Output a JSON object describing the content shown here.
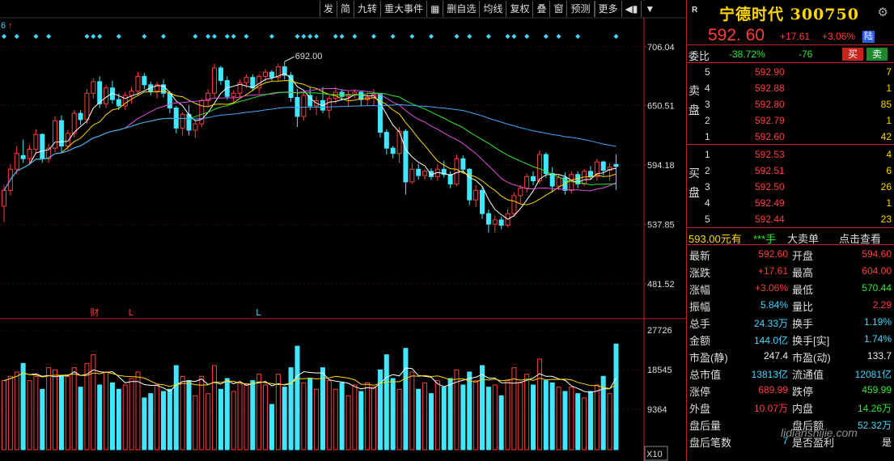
{
  "toolbar": {
    "items": [
      "发",
      "简",
      "九转",
      "重大事件",
      "",
      "删自选",
      "均线",
      "复权",
      "叠",
      "窗",
      "预测",
      "",
      "更多",
      "",
      ""
    ]
  },
  "header": {
    "r_badge": "R",
    "title": "宁德时代 300750",
    "settings_icon": "gear-icon"
  },
  "quote": {
    "price": "592. 60",
    "change": "+17.61",
    "change_pct": "+3.06%",
    "market_badge": "陆"
  },
  "weibi": {
    "label": "委比",
    "ratio": "-38.72%",
    "diff": "-76",
    "buy_label": "买",
    "sell_label": "卖"
  },
  "order_book": {
    "ask_side_label": [
      "卖",
      "盘"
    ],
    "bid_side_label": [
      "买",
      "盘"
    ],
    "asks": [
      {
        "level": "5",
        "price": "592.90",
        "vol": "7"
      },
      {
        "level": "4",
        "price": "592.88",
        "vol": "1"
      },
      {
        "level": "3",
        "price": "592.80",
        "vol": "85"
      },
      {
        "level": "2",
        "price": "592.79",
        "vol": "1"
      },
      {
        "level": "1",
        "price": "592.60",
        "vol": "42"
      }
    ],
    "bids": [
      {
        "level": "1",
        "price": "592.53",
        "vol": "4"
      },
      {
        "level": "2",
        "price": "592.51",
        "vol": "6"
      },
      {
        "level": "3",
        "price": "592.50",
        "vol": "26"
      },
      {
        "level": "4",
        "price": "592.49",
        "vol": "1"
      },
      {
        "level": "5",
        "price": "592.44",
        "vol": "23"
      }
    ]
  },
  "big_order": {
    "price": "593.00元有",
    "hand": "***手",
    "trade": "大卖单",
    "query": "点击查看"
  },
  "stats": [
    {
      "l1": "最新",
      "v1": "592.60",
      "c1": "red",
      "l2": "开盘",
      "v2": "594.60",
      "c2": "red"
    },
    {
      "l1": "涨跌",
      "v1": "+17.61",
      "c1": "red",
      "l2": "最高",
      "v2": "604.00",
      "c2": "red"
    },
    {
      "l1": "涨幅",
      "v1": "+3.06%",
      "c1": "red",
      "l2": "最低",
      "v2": "570.44",
      "c2": "green"
    },
    {
      "l1": "振幅",
      "v1": "5.84%",
      "c1": "cyan",
      "l2": "量比",
      "v2": "2.29",
      "c2": "red"
    },
    {
      "l1": "总手",
      "v1": "24.33万",
      "c1": "cyan",
      "l2": "换手",
      "v2": "1.19%",
      "c2": "cyan"
    },
    {
      "l1": "金额",
      "v1": "144.0亿",
      "c1": "cyan",
      "l2": "换手[实]",
      "v2": "1.74%",
      "c2": "cyan"
    },
    {
      "l1": "市盈(静)",
      "v1": "247.4",
      "c1": "white",
      "l2": "市盈(动)",
      "v2": "133.7",
      "c2": "white"
    },
    {
      "l1": "总市值",
      "v1": "13813亿",
      "c1": "cyan",
      "l2": "流通值",
      "v2": "12081亿",
      "c2": "cyan"
    },
    {
      "l1": "涨停",
      "v1": "689.99",
      "c1": "red",
      "l2": "跌停",
      "v2": "459.99",
      "c2": "green"
    },
    {
      "l1": "外盘",
      "v1": "10.07万",
      "c1": "red",
      "l2": "内盘",
      "v2": "14.26万",
      "c2": "green"
    },
    {
      "l1": "盘后量",
      "v1": "",
      "c1": "cyan",
      "l2": "盘后额",
      "v2": "52.32万",
      "c2": "cyan"
    },
    {
      "l1": "盘后笔数",
      "v1": "7",
      "c1": "cyan",
      "l2": "是否盈利",
      "v2": "是",
      "c2": "white"
    }
  ],
  "watermark": "lidianshijie.com",
  "chart_data": {
    "type": "candlestick",
    "price_axis_labels": [
      "706.04",
      "650.51",
      "594.18",
      "537.85",
      "481.52"
    ],
    "price_ticks": [
      706.04,
      650.51,
      594.18,
      537.85,
      481.52
    ],
    "volume_axis_labels": [
      "27726",
      "18545",
      "9364"
    ],
    "volume_ticks": [
      27726,
      18545,
      9364
    ],
    "volume_unit": "X10",
    "corner_label": "6",
    "high_annotation": "692.00",
    "markers": [
      {
        "text": "财",
        "bar": 14
      },
      {
        "text": "L",
        "bar": 20
      },
      {
        "text": "L",
        "bar": 40
      }
    ],
    "ohlc": [
      [
        555,
        575,
        540,
        570
      ],
      [
        570,
        595,
        565,
        590
      ],
      [
        590,
        612,
        585,
        605
      ],
      [
        603,
        618,
        596,
        600
      ],
      [
        600,
        613,
        594,
        609
      ],
      [
        609,
        628,
        605,
        623
      ],
      [
        623,
        624,
        596,
        600
      ],
      [
        600,
        614,
        596,
        610
      ],
      [
        610,
        640,
        606,
        636
      ],
      [
        636,
        641,
        606,
        612
      ],
      [
        612,
        627,
        608,
        624
      ],
      [
        624,
        646,
        620,
        643
      ],
      [
        643,
        646,
        632,
        637
      ],
      [
        637,
        666,
        633,
        662
      ],
      [
        662,
        676,
        657,
        673
      ],
      [
        673,
        678,
        648,
        652
      ],
      [
        652,
        670,
        648,
        667
      ],
      [
        667,
        674,
        652,
        656
      ],
      [
        656,
        662,
        646,
        650
      ],
      [
        650,
        663,
        646,
        660
      ],
      [
        660,
        668,
        652,
        664
      ],
      [
        664,
        682,
        660,
        678
      ],
      [
        678,
        681,
        666,
        670
      ],
      [
        670,
        673,
        660,
        664
      ],
      [
        664,
        673,
        657,
        670
      ],
      [
        670,
        675,
        658,
        662
      ],
      [
        662,
        664,
        643,
        648
      ],
      [
        648,
        650,
        624,
        629
      ],
      [
        629,
        644,
        622,
        642
      ],
      [
        642,
        651,
        622,
        627
      ],
      [
        627,
        635,
        620,
        633
      ],
      [
        633,
        657,
        630,
        655
      ],
      [
        655,
        666,
        650,
        662
      ],
      [
        662,
        690,
        658,
        686
      ],
      [
        686,
        688,
        670,
        674
      ],
      [
        674,
        678,
        656,
        659
      ],
      [
        659,
        665,
        652,
        662
      ],
      [
        662,
        675,
        658,
        672
      ],
      [
        672,
        680,
        667,
        677
      ],
      [
        677,
        680,
        664,
        667
      ],
      [
        667,
        680,
        662,
        678
      ],
      [
        678,
        685,
        673,
        682
      ],
      [
        682,
        684,
        674,
        677
      ],
      [
        677,
        690,
        673,
        687
      ],
      [
        687,
        692,
        675,
        679
      ],
      [
        679,
        682,
        654,
        658
      ],
      [
        658,
        666,
        630,
        640
      ],
      [
        640,
        664,
        636,
        660
      ],
      [
        660,
        668,
        646,
        650
      ],
      [
        650,
        659,
        641,
        655
      ],
      [
        655,
        668,
        643,
        646
      ],
      [
        646,
        660,
        638,
        657
      ],
      [
        657,
        668,
        652,
        663
      ],
      [
        663,
        666,
        655,
        659
      ],
      [
        659,
        664,
        650,
        661
      ],
      [
        661,
        666,
        657,
        663
      ],
      [
        663,
        664,
        650,
        656
      ],
      [
        656,
        663,
        650,
        658
      ],
      [
        658,
        666,
        650,
        661
      ],
      [
        661,
        662,
        620,
        625
      ],
      [
        625,
        628,
        604,
        610
      ],
      [
        610,
        612,
        600,
        605
      ],
      [
        605,
        630,
        596,
        626
      ],
      [
        626,
        628,
        566,
        578
      ],
      [
        578,
        596,
        576,
        590
      ],
      [
        590,
        595,
        580,
        584
      ],
      [
        584,
        590,
        580,
        588
      ],
      [
        588,
        591,
        580,
        583
      ],
      [
        583,
        595,
        579,
        590
      ],
      [
        590,
        598,
        582,
        585
      ],
      [
        585,
        588,
        572,
        576
      ],
      [
        576,
        604,
        574,
        600
      ],
      [
        600,
        603,
        586,
        590
      ],
      [
        590,
        591,
        556,
        561
      ],
      [
        561,
        575,
        554,
        570
      ],
      [
        570,
        574,
        543,
        548
      ],
      [
        548,
        552,
        530,
        538
      ],
      [
        538,
        546,
        530,
        542
      ],
      [
        542,
        545,
        533,
        537
      ],
      [
        537,
        552,
        535,
        548
      ],
      [
        548,
        568,
        545,
        565
      ],
      [
        565,
        575,
        558,
        572
      ],
      [
        572,
        586,
        568,
        583
      ],
      [
        583,
        588,
        575,
        579
      ],
      [
        579,
        608,
        576,
        604
      ],
      [
        604,
        606,
        582,
        586
      ],
      [
        586,
        592,
        568,
        574
      ],
      [
        574,
        585,
        570,
        582
      ],
      [
        582,
        587,
        566,
        570
      ],
      [
        570,
        588,
        567,
        585
      ],
      [
        585,
        588,
        572,
        576
      ],
      [
        576,
        590,
        574,
        588
      ],
      [
        588,
        593,
        580,
        583
      ],
      [
        583,
        600,
        579,
        597
      ],
      [
        597,
        598,
        584,
        589
      ],
      [
        589,
        596,
        579,
        592
      ],
      [
        594.6,
        604,
        570.44,
        592.6
      ]
    ],
    "volume": [
      16000,
      17000,
      18000,
      20000,
      16000,
      17000,
      14000,
      19000,
      18500,
      17000,
      17000,
      19000,
      14500,
      20000,
      22000,
      15000,
      18000,
      15500,
      14000,
      15000,
      16500,
      18000,
      12000,
      13000,
      15000,
      13500,
      14000,
      19500,
      17000,
      16000,
      12500,
      17000,
      13000,
      19500,
      14000,
      16500,
      13500,
      15500,
      15000,
      16000,
      17500,
      15000,
      10500,
      17500,
      14500,
      19000,
      24000,
      15500,
      16500,
      14000,
      19000,
      16000,
      14000,
      15500,
      12500,
      15000,
      13500,
      15500,
      14500,
      18500,
      22000,
      16500,
      14000,
      23500,
      18000,
      14000,
      15500,
      13000,
      16000,
      14500,
      16500,
      18500,
      15000,
      18000,
      16000,
      19500,
      14500,
      15000,
      12500,
      16000,
      19000,
      15500,
      17500,
      15000,
      21000,
      16000,
      15500,
      14500,
      13500,
      14500,
      13000,
      12000,
      13500,
      15000,
      17000,
      13000,
      24500
    ]
  }
}
